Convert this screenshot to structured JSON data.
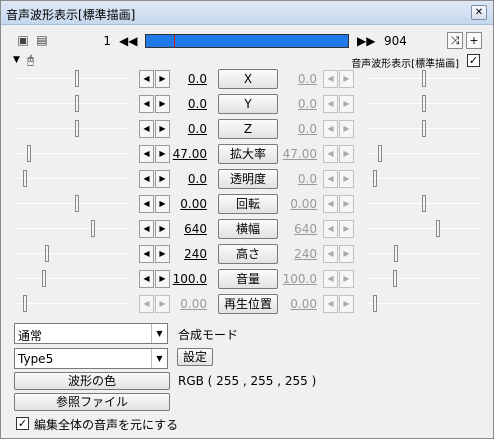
{
  "window": {
    "title": "音声波形表示[標準描画]",
    "close_glyph": "✕"
  },
  "toolbar": {
    "frame_start": "1",
    "frame_end": "904",
    "prev_glyph": "◀◀",
    "next_glyph": "▶▶",
    "cut_glyph": "⤨",
    "plus_glyph": "+",
    "timeline_color": "#1f7ae8",
    "playhead_color": "#d21414"
  },
  "object": {
    "name": "音声波形表示[標準描画]",
    "checked": "✓",
    "caret": "▼",
    "mouse_glyph": "🖰"
  },
  "params": [
    {
      "label": "X",
      "start": "0.0",
      "end": "0.0"
    },
    {
      "label": "Y",
      "start": "0.0",
      "end": "0.0"
    },
    {
      "label": "Z",
      "start": "0.0",
      "end": "0.0"
    },
    {
      "label": "拡大率",
      "start": "47.00",
      "end": "47.00"
    },
    {
      "label": "透明度",
      "start": "0.0",
      "end": "0.0"
    },
    {
      "label": "回転",
      "start": "0.00",
      "end": "0.00"
    },
    {
      "label": "横幅",
      "start": "640",
      "end": "640"
    },
    {
      "label": "高さ",
      "start": "240",
      "end": "240"
    },
    {
      "label": "音量",
      "start": "100.0",
      "end": "100.0"
    },
    {
      "label": "再生位置",
      "start": "0.00",
      "end": "0.00"
    }
  ],
  "arrows": {
    "left": "◀",
    "right": "▶"
  },
  "blend": {
    "value": "通常",
    "label": "合成モード"
  },
  "type": {
    "value": "Type5",
    "settings_label": "設定"
  },
  "wave_color": {
    "button": "波形の色",
    "rgb": "RGB ( 255 , 255 , 255 )"
  },
  "ref_file": {
    "button": "参照ファイル"
  },
  "whole_edit": {
    "checked": "✓",
    "label": "編集全体の音声を元にする"
  }
}
